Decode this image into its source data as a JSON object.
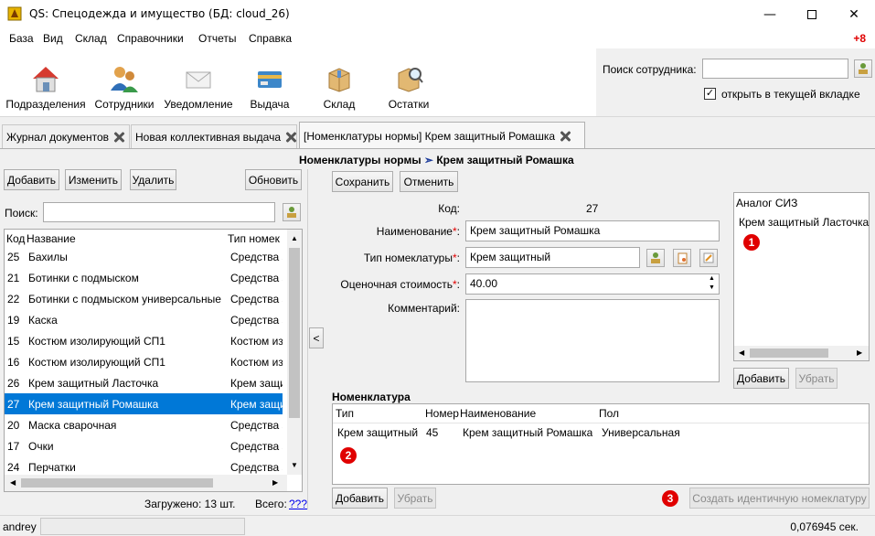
{
  "window": {
    "title": "QS: Спецодежда и имущество (БД: cloud_26)"
  },
  "menu": {
    "items": [
      "База",
      "Вид",
      "Склад",
      "Справочники",
      "Отчеты",
      "Справка"
    ],
    "notification": "+8"
  },
  "toolbar": {
    "items": [
      {
        "label": "Подразделения",
        "icon": "house-icon"
      },
      {
        "label": "Сотрудники",
        "icon": "people-icon"
      },
      {
        "label": "Уведомление",
        "icon": "envelope-icon"
      },
      {
        "label": "Выдача",
        "icon": "card-icon"
      },
      {
        "label": "Склад",
        "icon": "box-icon"
      },
      {
        "label": "Остатки",
        "icon": "box-search-icon"
      }
    ]
  },
  "employee_search": {
    "label": "Поиск сотрудника:",
    "value": "",
    "checkbox_label": "открыть в текущей вкладке",
    "checked": true
  },
  "tabs": [
    {
      "label": "Журнал документов",
      "active": false
    },
    {
      "label": "Новая коллективная выдача",
      "active": false
    },
    {
      "label": "[Номенклатуры нормы] Крем защитный Ромашка",
      "active": true
    }
  ],
  "breadcrumb": {
    "parent": "Номенклатуры нормы",
    "separator": "➣",
    "current": "Крем защитный Ромашка"
  },
  "left": {
    "buttons": {
      "add": "Добавить",
      "edit": "Изменить",
      "delete": "Удалить",
      "refresh": "Обновить"
    },
    "search_label": "Поиск:",
    "search_value": "",
    "columns": [
      "Код",
      "Название",
      "Тип номек"
    ],
    "rows": [
      {
        "code": "25",
        "name": "Бахилы",
        "type": "Средства з",
        "selected": false
      },
      {
        "code": "21",
        "name": "Ботинки с подмыском",
        "type": "Средства з",
        "selected": false
      },
      {
        "code": "22",
        "name": "Ботинки с подмыском универсальные",
        "type": "Средства з",
        "selected": false
      },
      {
        "code": "19",
        "name": "Каска",
        "type": "Средства з",
        "selected": false
      },
      {
        "code": "15",
        "name": "Костюм изолирующий СП1",
        "type": "Костюм из",
        "selected": false
      },
      {
        "code": "16",
        "name": "Костюм изолирующий СП1",
        "type": "Костюм из",
        "selected": false
      },
      {
        "code": "26",
        "name": "Крем защитный Ласточка",
        "type": "Крем защи",
        "selected": false
      },
      {
        "code": "27",
        "name": "Крем защитный Ромашка",
        "type": "Крем защи",
        "selected": true
      },
      {
        "code": "20",
        "name": "Маска сварочная",
        "type": "Средства з",
        "selected": false
      },
      {
        "code": "17",
        "name": "Очки",
        "type": "Средства з",
        "selected": false
      },
      {
        "code": "24",
        "name": "Перчатки",
        "type": "Средства з",
        "selected": false
      }
    ],
    "loaded": "Загружено: 13 шт.",
    "total_label": "Всего:",
    "total_link": "???"
  },
  "collapse_button": "<",
  "form": {
    "save": "Сохранить",
    "cancel": "Отменить",
    "code_label": "Код:",
    "code_value": "27",
    "name_label": "Наименование",
    "name_value": "Крем защитный Ромашка",
    "type_label": "Тип номеклатуры",
    "type_value": "Крем защитный",
    "cost_label": "Оценочная стоимость",
    "cost_value": "40.00",
    "comment_label": "Комментарий:",
    "comment_value": "",
    "required_mark": "*",
    "colon": ":"
  },
  "analog": {
    "header": "Аналог СИЗ",
    "items": [
      "Крем защитный Ласточка"
    ],
    "add": "Добавить",
    "remove": "Убрать"
  },
  "nomenclature": {
    "title": "Номенклатура",
    "columns": [
      "Тип",
      "Номер",
      "Наименование",
      "Пол"
    ],
    "rows": [
      {
        "type": "Крем защитный",
        "number": "45",
        "name": "Крем защитный Ромашка",
        "gender": "Универсальная"
      }
    ],
    "add": "Добавить",
    "remove": "Убрать",
    "create_identical": "Создать идентичную номеклатуру"
  },
  "badges": [
    "1",
    "2",
    "3"
  ],
  "status": {
    "user": "andrey",
    "timing": "0,076945 сек."
  },
  "colors": {
    "accent": "#0078d7",
    "required": "#e00000",
    "link": "#0000ee"
  }
}
